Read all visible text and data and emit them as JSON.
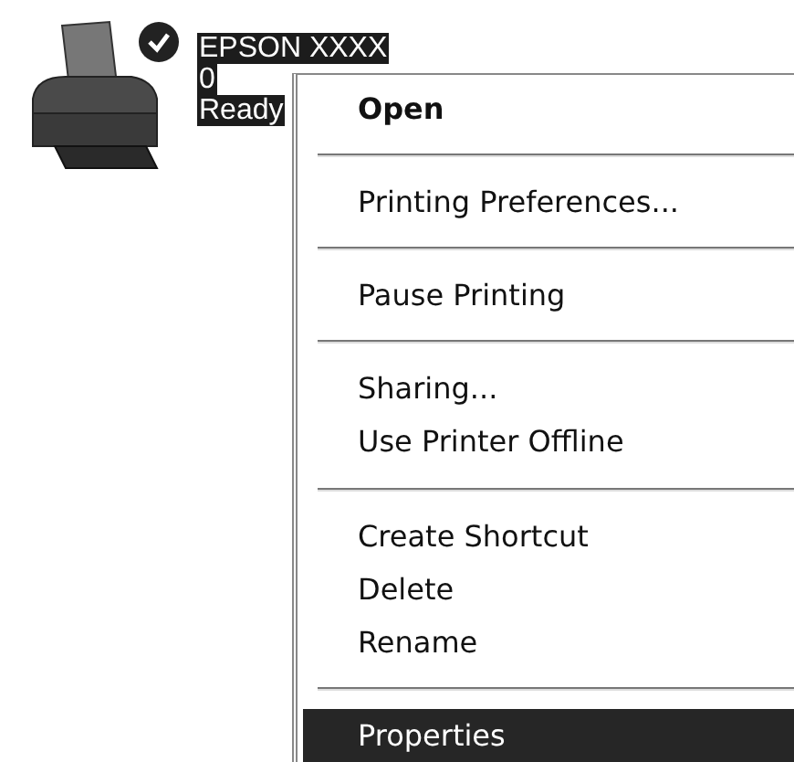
{
  "printer": {
    "lines": [
      "EPSON XXXX",
      "0",
      "Ready"
    ],
    "default": true,
    "selected": true
  },
  "context_menu": {
    "items": [
      {
        "kind": "item",
        "label": "Open",
        "default": true,
        "selected": false
      },
      {
        "kind": "separator"
      },
      {
        "kind": "item",
        "label": "Printing Preferences...",
        "default": false,
        "selected": false
      },
      {
        "kind": "separator"
      },
      {
        "kind": "item",
        "label": "Pause Printing",
        "default": false,
        "selected": false
      },
      {
        "kind": "separator"
      },
      {
        "kind": "item",
        "label": "Sharing...",
        "default": false,
        "selected": false
      },
      {
        "kind": "item",
        "label": "Use Printer Offline",
        "default": false,
        "selected": false
      },
      {
        "kind": "separator"
      },
      {
        "kind": "item",
        "label": "Create Shortcut",
        "default": false,
        "selected": false
      },
      {
        "kind": "item",
        "label": "Delete",
        "default": false,
        "selected": false
      },
      {
        "kind": "item",
        "label": "Rename",
        "default": false,
        "selected": false
      },
      {
        "kind": "separator"
      },
      {
        "kind": "item",
        "label": "Properties",
        "default": false,
        "selected": true
      }
    ]
  }
}
